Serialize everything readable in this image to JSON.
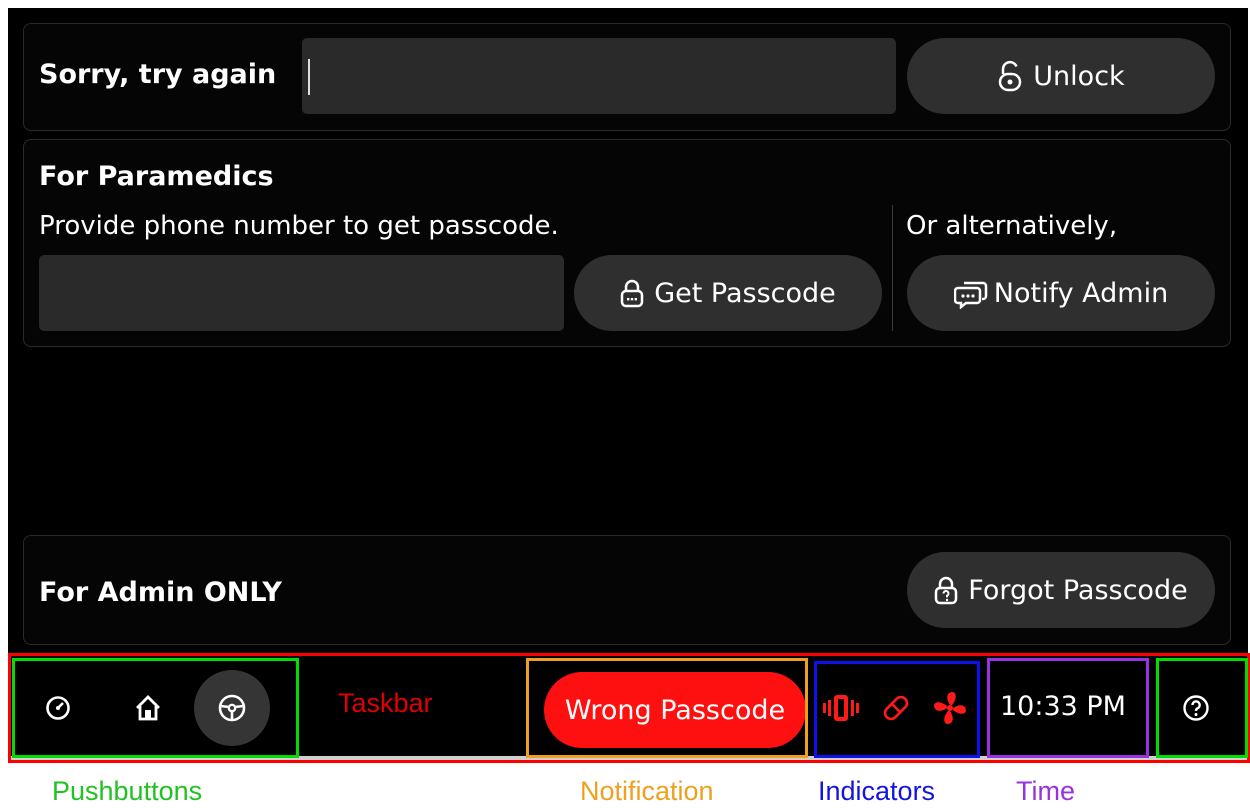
{
  "unlock_panel": {
    "status_label": "Sorry, try again",
    "passcode_value": "",
    "unlock_button": "Unlock"
  },
  "paramedics_panel": {
    "heading": "For Paramedics",
    "instruction": "Provide phone number to get passcode.",
    "phone_value": "",
    "get_passcode_button": "Get Passcode",
    "alternative_text": "Or alternatively,",
    "notify_admin_button": "Notify Admin"
  },
  "admin_panel": {
    "heading": "For Admin ONLY",
    "forgot_passcode_button": "Forgot Passcode"
  },
  "taskbar": {
    "label": "Taskbar",
    "pushbuttons": [
      "speedometer-icon",
      "home-icon",
      "steering-wheel-icon"
    ],
    "notification": "Wrong Passcode",
    "indicators": [
      "vibration-icon",
      "pill-icon",
      "fan-icon"
    ],
    "time": "10:33 PM",
    "help_icon": "help-icon"
  },
  "annotations": {
    "pushbuttons": "Pushbuttons",
    "notification": "Notification",
    "indicators": "Indicators",
    "time": "Time"
  },
  "colors": {
    "background": "#000000",
    "field": "#2a2a2a",
    "button": "#2f2f2f",
    "notification": "#ff1010",
    "indicator": "#ff1a1a",
    "taskbar_frame": "#ff0000",
    "pushbuttons_frame": "#00dd00",
    "notification_frame": "#f0a020",
    "indicators_frame": "#1010ee",
    "time_frame": "#9a30e0"
  }
}
